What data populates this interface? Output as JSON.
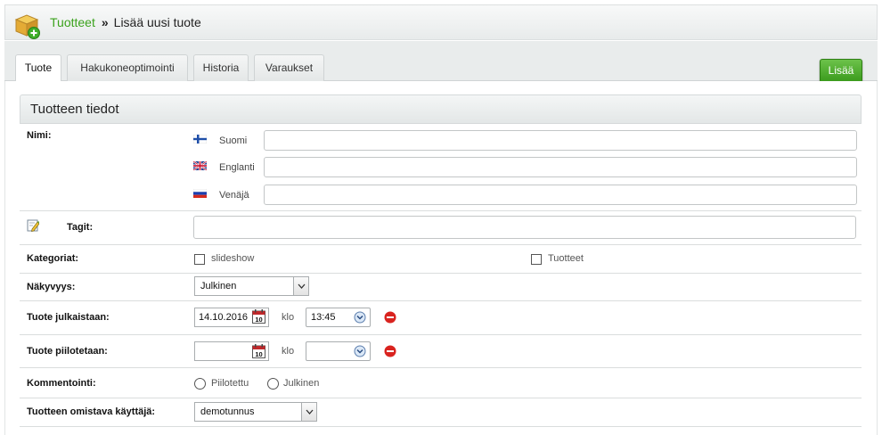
{
  "breadcrumb": {
    "parent": "Tuotteet",
    "separator": "»",
    "current": "Lisää uusi tuote"
  },
  "tabs": [
    {
      "label": "Tuote",
      "active": true
    },
    {
      "label": "Hakukoneoptimointi",
      "active": false
    },
    {
      "label": "Historia",
      "active": false
    },
    {
      "label": "Varaukset",
      "active": false
    }
  ],
  "actions": {
    "add_label": "Lisää"
  },
  "section": {
    "title": "Tuotteen tiedot"
  },
  "fields": {
    "name": {
      "label": "Nimi:",
      "languages": [
        {
          "label": "Suomi",
          "value": ""
        },
        {
          "label": "Englanti",
          "value": ""
        },
        {
          "label": "Venäjä",
          "value": ""
        }
      ]
    },
    "tags": {
      "label": "Tagit:",
      "value": ""
    },
    "categories": {
      "label": "Kategoriat:",
      "options": [
        {
          "label": "slideshow",
          "checked": false
        },
        {
          "label": "Tuotteet",
          "checked": false
        }
      ]
    },
    "visibility": {
      "label": "Näkyvyys:",
      "value": "Julkinen"
    },
    "publish": {
      "label": "Tuote julkaistaan:",
      "date": "14.10.2016",
      "at": "klo",
      "time": "13:45"
    },
    "hide": {
      "label": "Tuote piilotetaan:",
      "date": "",
      "at": "klo",
      "time": ""
    },
    "commenting": {
      "label": "Kommentointi:",
      "options": [
        {
          "label": "Piilotettu",
          "selected": false
        },
        {
          "label": "Julkinen",
          "selected": false
        }
      ]
    },
    "owner": {
      "label": "Tuotteen omistava käyttäjä:",
      "value": "demotunnus"
    }
  },
  "icons": {
    "calendar_day": "10",
    "colors": {
      "accent_green": "#3aa21c",
      "button_green": "#4aab28",
      "remove_red": "#d9231f"
    }
  }
}
